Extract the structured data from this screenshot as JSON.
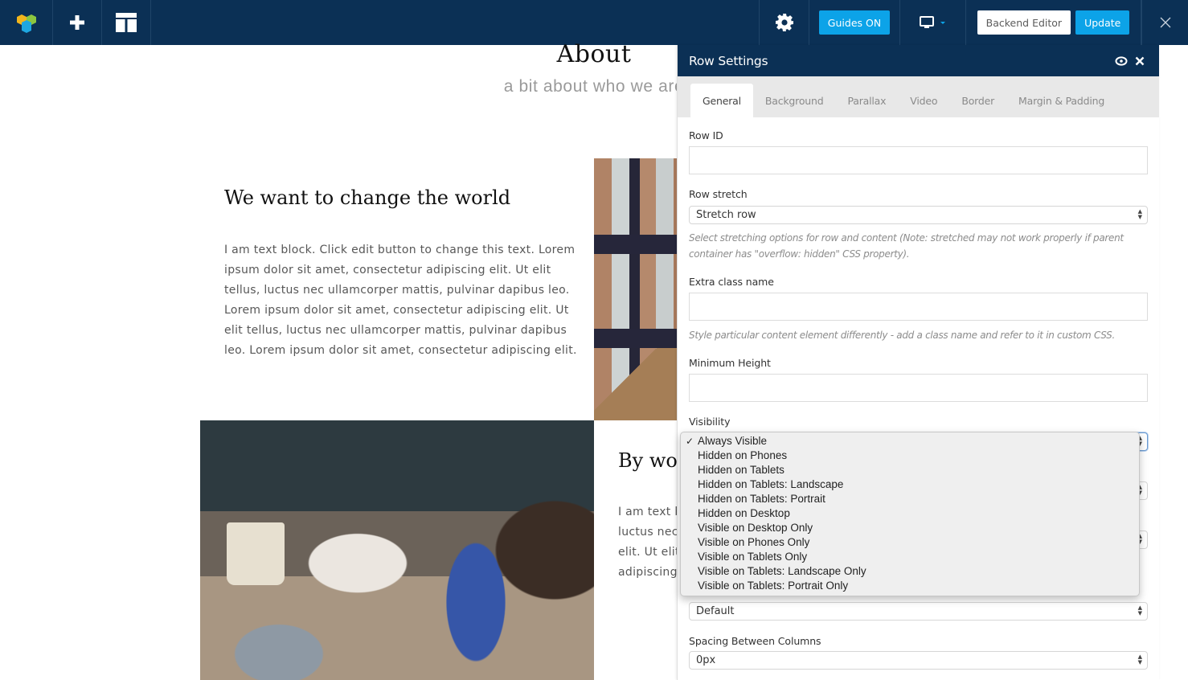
{
  "toolbar": {
    "logo_icon": "visual-composer-logo-icon",
    "add_icon": "plus-icon",
    "layout_icon": "layout-grid-icon",
    "settings_icon": "gear-icon",
    "guides_label": "Guides ON",
    "device_icon": "desktop-monitor-icon",
    "backend_editor_label": "Backend Editor",
    "update_label": "Update",
    "close_icon": "close-icon",
    "colors": {
      "bar": "#0b3055",
      "accent": "#0ca3e8"
    }
  },
  "page": {
    "section_title": "About",
    "section_subtitle": "a bit about who we are",
    "block1": {
      "heading": "We want to change the world",
      "text": "I am text block. Click edit button to change this text. Lorem ipsum dolor sit amet, consectetur adipiscing elit. Ut elit tellus, luctus nec ullamcorper mattis, pulvinar dapibus leo. Lorem ipsum dolor sit amet, consectetur adipiscing elit. Ut elit tellus, luctus nec ullamcorper mattis, pulvinar dapibus leo. Lorem ipsum dolor sit amet, consectetur adipiscing elit."
    },
    "block2": {
      "heading": "By wo",
      "text": "I am text block. Lorem ipsum dolor sit amet. Ut elit tellus, luctus nec ullamcorper dapibus leo. Lorem ipsum adipiscing elit. Ut elit mattis, pulvinar dapibus leo. consectetur adipiscing elit."
    }
  },
  "panel": {
    "title": "Row Settings",
    "preview_icon": "eye-icon",
    "close_icon": "close-icon",
    "tabs": [
      {
        "label": "General",
        "active": true
      },
      {
        "label": "Background",
        "active": false
      },
      {
        "label": "Parallax",
        "active": false
      },
      {
        "label": "Video",
        "active": false
      },
      {
        "label": "Border",
        "active": false
      },
      {
        "label": "Margin & Padding",
        "active": false
      }
    ],
    "fields": {
      "row_id": {
        "label": "Row ID",
        "value": ""
      },
      "row_stretch": {
        "label": "Row stretch",
        "value": "Stretch row",
        "hint": "Select stretching options for row and content (Note: stretched may not work properly if parent container has \"overflow: hidden\" CSS property)."
      },
      "extra_class": {
        "label": "Extra class name",
        "value": "",
        "hint": "Style particular content element differently - add a class name and refer to it in custom CSS."
      },
      "min_height": {
        "label": "Minimum Height",
        "value": ""
      },
      "visibility": {
        "label": "Visibility",
        "value": "Always Visible",
        "options": [
          "Always Visible",
          "Hidden on Phones",
          "Hidden on Tablets",
          "Hidden on Tablets: Landscape",
          "Hidden on Tablets: Portrait",
          "Hidden on Desktop",
          "Visible on Desktop Only",
          "Visible on Phones Only",
          "Visible on Tablets Only",
          "Visible on Tablets: Landscape Only",
          "Visible on Tablets: Portrait Only"
        ]
      },
      "typography": {
        "value": "Default"
      },
      "spacing": {
        "label": "Spacing Between Columns",
        "value": "0px"
      }
    }
  }
}
